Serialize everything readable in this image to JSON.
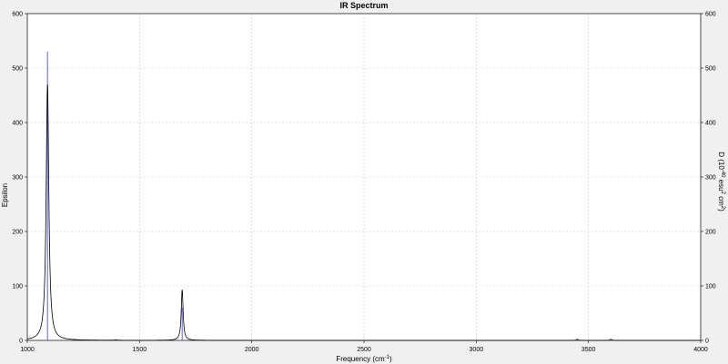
{
  "chart_data": {
    "type": "line",
    "title": "IR Spectrum",
    "xlabel": "Frequency (cm",
    "xlabel_sup": "-1",
    "xlabel_end": ")",
    "ylabel": "Epsilon",
    "ylabel_right": {
      "prefix": "D (10",
      "sup1": "-40",
      "mid": " esu",
      "sup2": "2",
      "end": " cm",
      "sup3": "2",
      "close": ")"
    },
    "xlim": [
      1000,
      4000
    ],
    "ylim": [
      0,
      600
    ],
    "ylim_right": [
      0,
      600
    ],
    "xticks": [
      1000,
      1500,
      2000,
      2500,
      3000,
      3500,
      4000
    ],
    "yticks": [
      0,
      100,
      200,
      300,
      400,
      500,
      600
    ],
    "yticks_right": [
      0,
      100,
      200,
      300,
      400,
      500,
      600
    ],
    "grid": true,
    "colors": {
      "spectrum": "#000000",
      "sticks": "#6060e0",
      "grid": "#c8c8c8",
      "plot_bg": "#ffffff"
    },
    "peaks": [
      {
        "x": 1090,
        "y": 470,
        "fwhm": 14
      },
      {
        "x": 1690,
        "y": 93,
        "fwhm": 10
      },
      {
        "x": 1395,
        "y": 1,
        "fwhm": 10
      },
      {
        "x": 3450,
        "y": 2,
        "fwhm": 10
      },
      {
        "x": 3600,
        "y": 2,
        "fwhm": 10
      }
    ],
    "sticks": [
      {
        "x": 1090,
        "y": 530
      },
      {
        "x": 1690,
        "y": 60
      }
    ]
  }
}
